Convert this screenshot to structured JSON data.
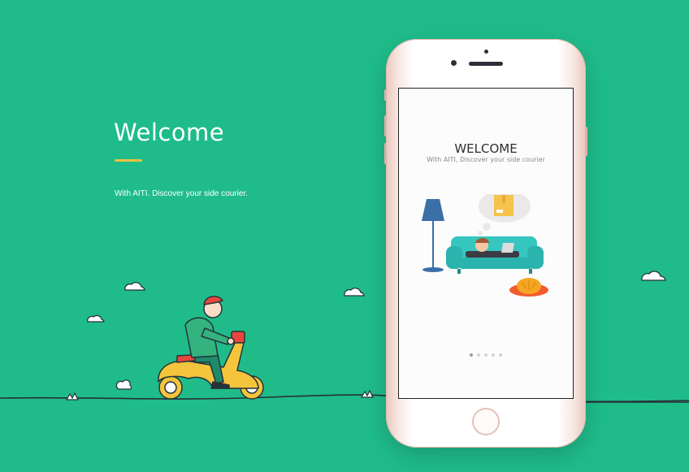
{
  "hero": {
    "title": "Welcome",
    "subtitle": "With AITI. Discover your side courier."
  },
  "phone": {
    "screen_title": "WELCOME",
    "screen_subtitle": "With AITI, Discover your side courier",
    "page_count": 5,
    "active_page": 1
  },
  "colors": {
    "background": "#1fbc8a",
    "accent_underline": "#f2c13f",
    "scooter": "#f4c43c",
    "sofa": "#2ec2b8"
  },
  "icons": [
    "cloud-icon",
    "scooter-rider-illustration",
    "lamp-illustration",
    "sofa-illustration",
    "package-bubble-icon",
    "cat-icon"
  ]
}
